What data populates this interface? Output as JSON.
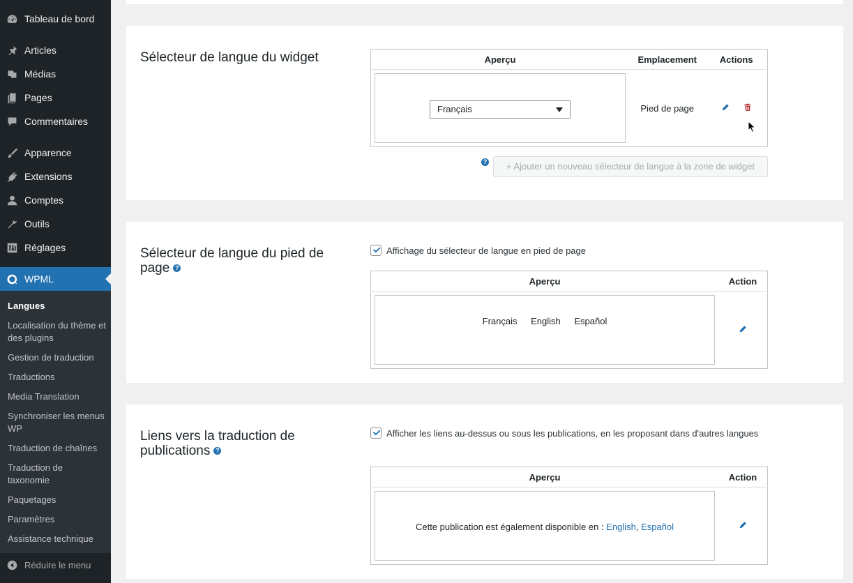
{
  "sidebar": {
    "items": [
      {
        "label": "Tableau de bord",
        "icon": "dashboard-icon"
      },
      {
        "label": "Articles",
        "icon": "pin-icon"
      },
      {
        "label": "Médias",
        "icon": "media-icon"
      },
      {
        "label": "Pages",
        "icon": "pages-icon"
      },
      {
        "label": "Commentaires",
        "icon": "comment-icon"
      },
      {
        "label": "Apparence",
        "icon": "brush-icon"
      },
      {
        "label": "Extensions",
        "icon": "plugin-icon"
      },
      {
        "label": "Comptes",
        "icon": "user-icon"
      },
      {
        "label": "Outils",
        "icon": "wrench-icon"
      },
      {
        "label": "Réglages",
        "icon": "settings-icon"
      },
      {
        "label": "WPML",
        "icon": "wpml-icon"
      }
    ],
    "submenu": [
      "Langues",
      "Localisation du thème et des plugins",
      "Gestion de traduction",
      "Traductions",
      "Media Translation",
      "Synchroniser les menus WP",
      "Traduction de chaînes",
      "Traduction de taxonomie",
      "Paquetages",
      "Paramètres",
      "Assistance technique"
    ],
    "collapse_label": "Réduire le menu"
  },
  "widget_section": {
    "title": "Sélecteur de langue du widget",
    "headers": {
      "preview": "Aperçu",
      "location": "Emplacement",
      "actions": "Actions"
    },
    "select_value": "Français",
    "location_value": "Pied de page",
    "add_button_label": "+ Ajouter un nouveau sélecteur de langue à la zone de widget"
  },
  "footer_section": {
    "title": "Sélecteur de langue du pied de page",
    "checkbox_label": "Affichage du sélecteur de langue en pied de page",
    "headers": {
      "preview": "Aperçu",
      "action": "Action"
    },
    "languages": [
      "Français",
      "English",
      "Español"
    ]
  },
  "post_links_section": {
    "title": "Liens vers la traduction de publications",
    "checkbox_label": "Afficher les liens au-dessus ou sous les publications, en les proposant dans d'autres langues",
    "headers": {
      "preview": "Aperçu",
      "action": "Action"
    },
    "preview_text": "Cette publication est également disponible en : ",
    "link_1": "English",
    "separator": ",",
    "link_2": "Español"
  },
  "colors": {
    "sidebar_bg": "#1d2327",
    "submenu_bg": "#2c3338",
    "accent": "#2271b1",
    "delete": "#b32d2e"
  }
}
